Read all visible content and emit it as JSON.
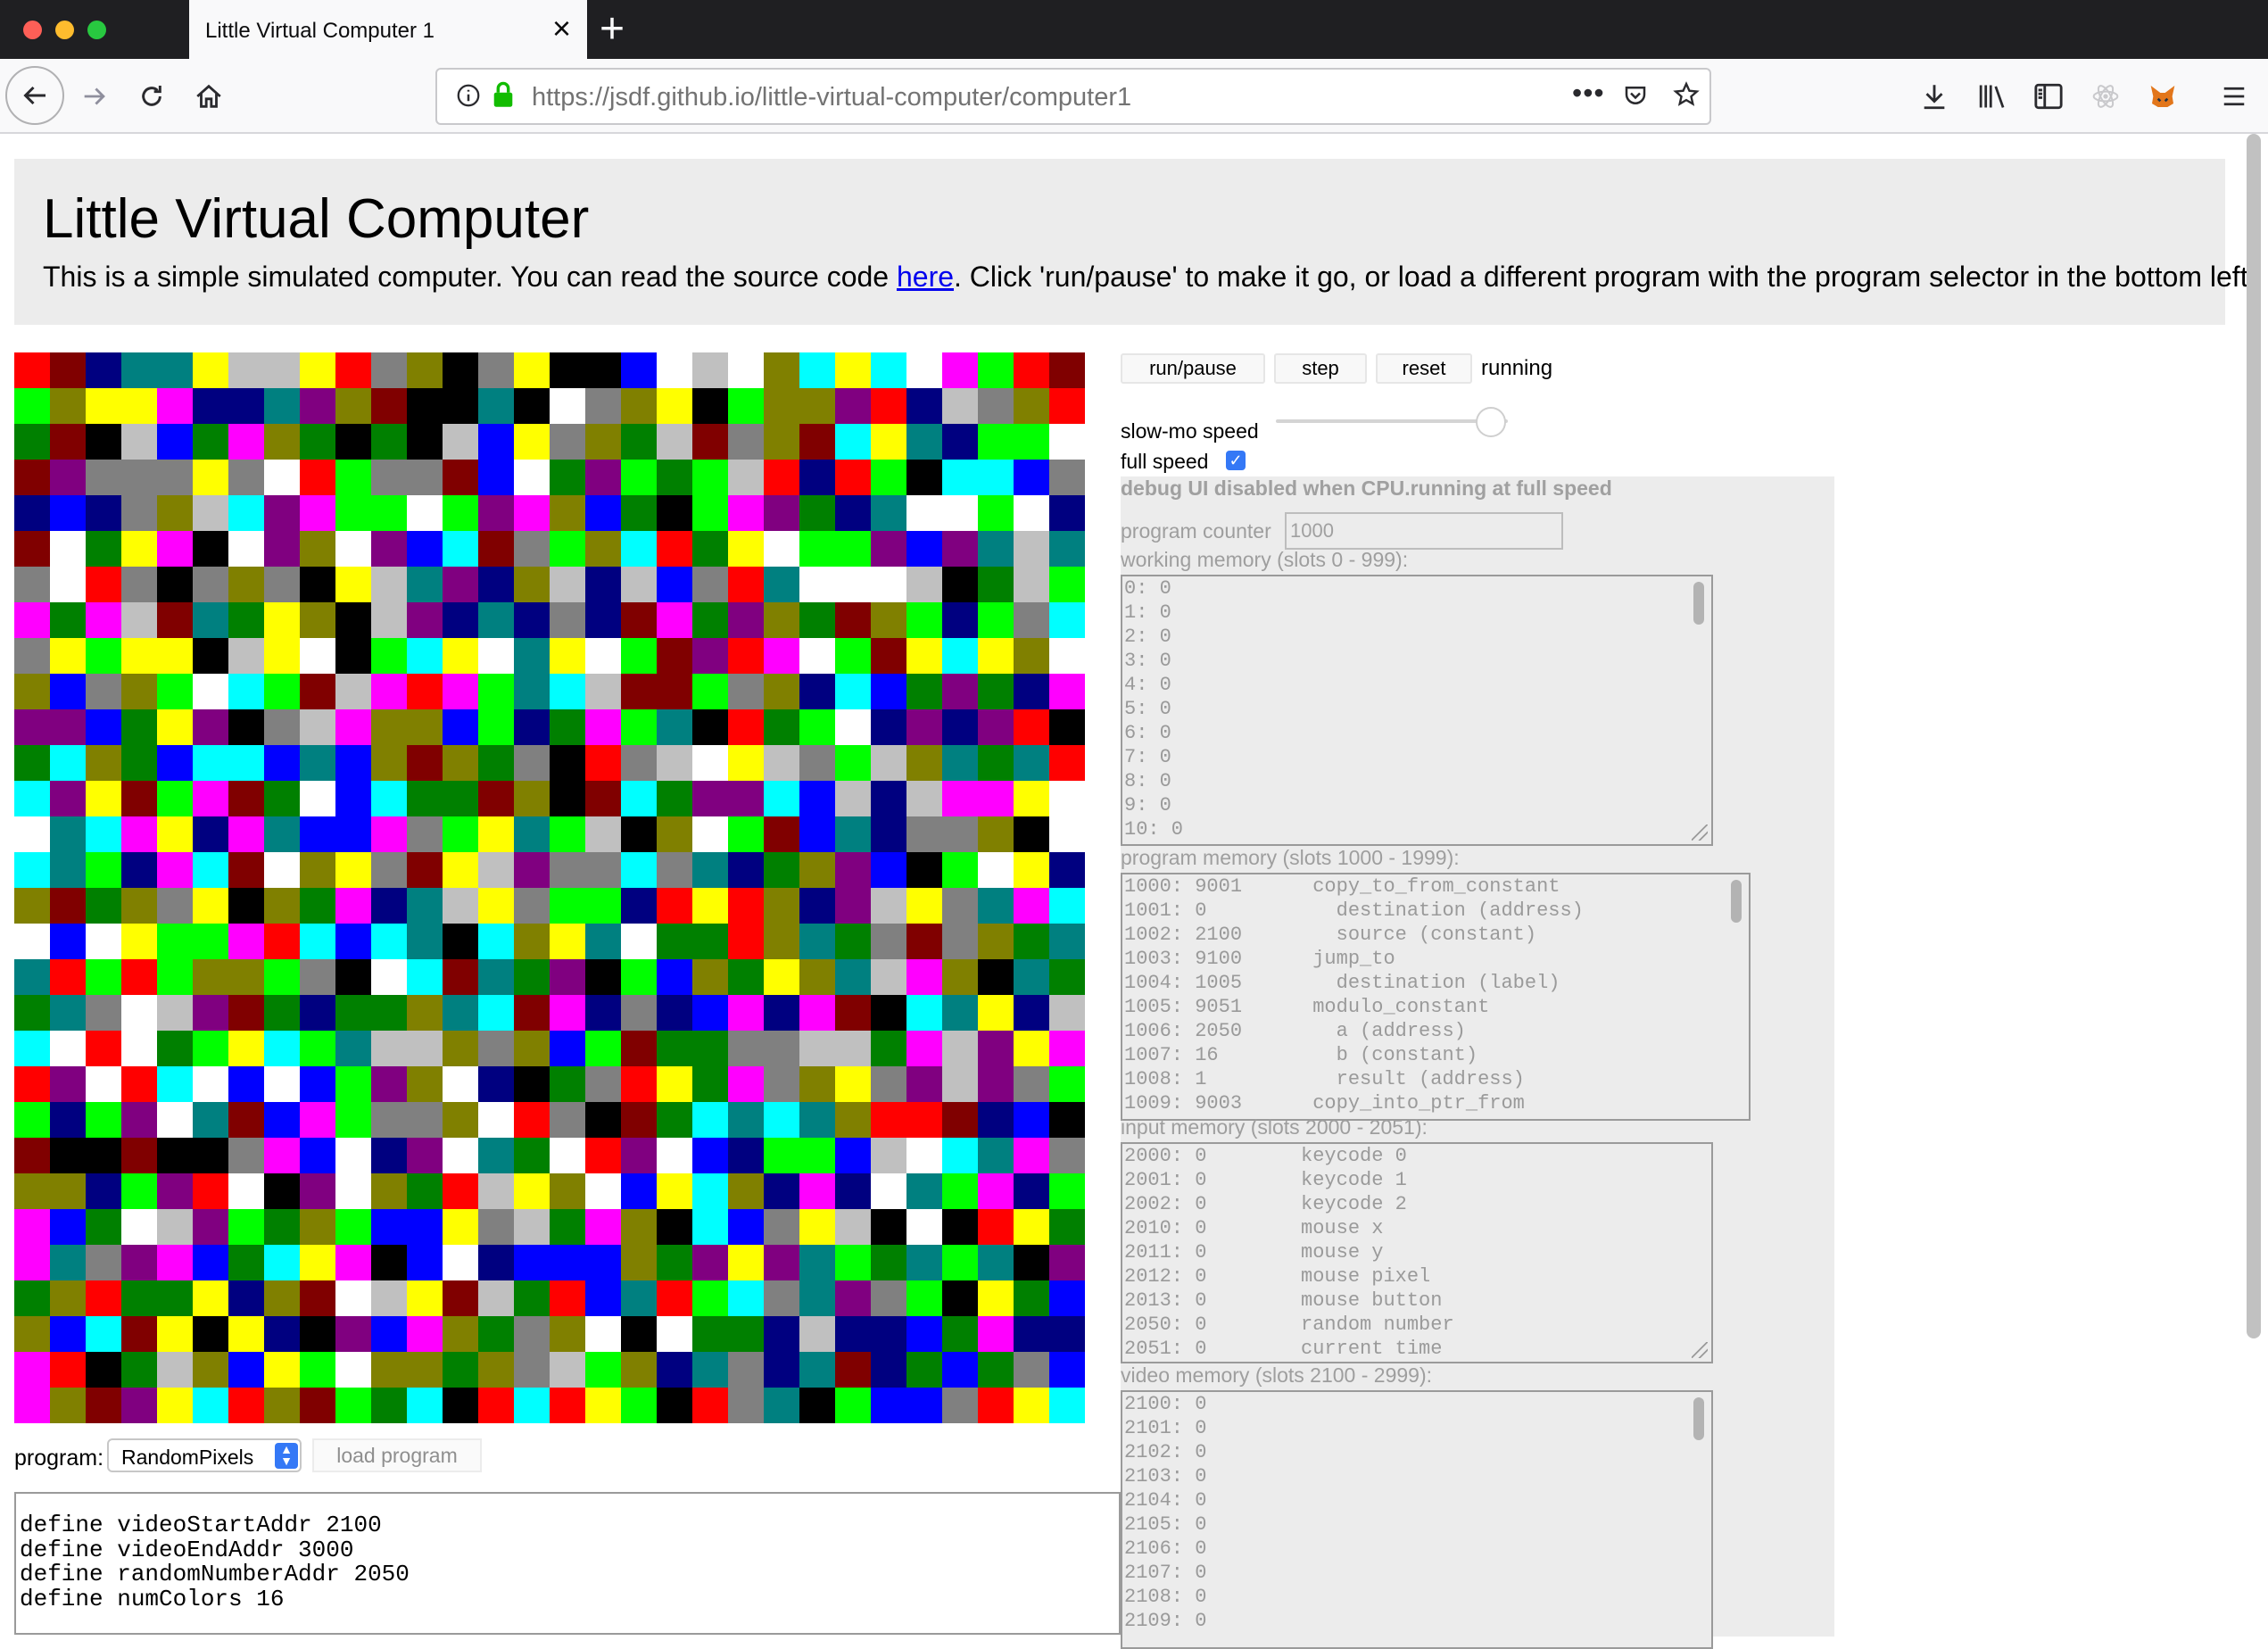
{
  "browser": {
    "tab_title": "Little Virtual Computer 1",
    "url_host": "https://jsdf.github.io",
    "url_path": "/little-virtual-computer/computer1"
  },
  "header": {
    "title": "Little Virtual Computer",
    "description_before": "This is a simple simulated computer. You can read the source code ",
    "link_text": "here",
    "description_after": ". Click 'run/pause' to make it go, or load a different program with the program selector in the bottom left."
  },
  "display": {
    "palette": [
      "#000000",
      "#0000ff",
      "#00ff00",
      "#00ffff",
      "#ff0000",
      "#ff00ff",
      "#ffff00",
      "#ffffff",
      "#808080",
      "#c0c0c0",
      "#800000",
      "#800080",
      "#008000",
      "#008080",
      "#808000",
      "#000080"
    ],
    "grid_cols": 30,
    "grid_rows": 30
  },
  "program": {
    "label": "program:",
    "selected": "RandomPixels",
    "load_label": "load program",
    "source_lines": [
      "define videoStartAddr 2100",
      "define videoEndAddr 3000",
      "define randomNumberAddr 2050",
      "define numColors 16"
    ]
  },
  "controls": {
    "run_pause": "run/pause",
    "step": "step",
    "reset": "reset",
    "status": "running",
    "slowmo_label": "slow-mo speed",
    "fullspeed_label": "full speed",
    "fullspeed_checked": true,
    "speed_level": 0.95
  },
  "debug": {
    "notice": "debug UI disabled when CPU.running at full speed",
    "pc_label": "program counter",
    "pc_value": "1000",
    "working_label": "working memory (slots 0 - 999):",
    "working_rows": [
      "0: 0",
      "1: 0",
      "2: 0",
      "3: 0",
      "4: 0",
      "5: 0",
      "6: 0",
      "7: 0",
      "8: 0",
      "9: 0",
      "10: 0"
    ],
    "program_label": "program memory (slots 1000 - 1999):",
    "program_rows": [
      "1000: 9001      copy_to_from_constant",
      "1001: 0           destination (address)",
      "1002: 2100        source (constant)",
      "1003: 9100      jump_to",
      "1004: 1005        destination (label)",
      "1005: 9051      modulo_constant",
      "1006: 2050        a (address)",
      "1007: 16          b (constant)",
      "1008: 1           result (address)",
      "1009: 9003      copy_into_ptr_from"
    ],
    "input_label": "input memory (slots 2000 - 2051):",
    "input_rows": [
      "2000: 0        keycode 0",
      "2001: 0        keycode 1",
      "2002: 0        keycode 2",
      "2010: 0        mouse x",
      "2011: 0        mouse y",
      "2012: 0        mouse pixel",
      "2013: 0        mouse button",
      "2050: 0        random number",
      "2051: 0        current time"
    ],
    "video_label": "video memory (slots 2100 - 2999):",
    "video_rows": [
      "2100: 0",
      "2101: 0",
      "2102: 0",
      "2103: 0",
      "2104: 0",
      "2105: 0",
      "2106: 0",
      "2107: 0",
      "2108: 0",
      "2109: 0"
    ]
  }
}
